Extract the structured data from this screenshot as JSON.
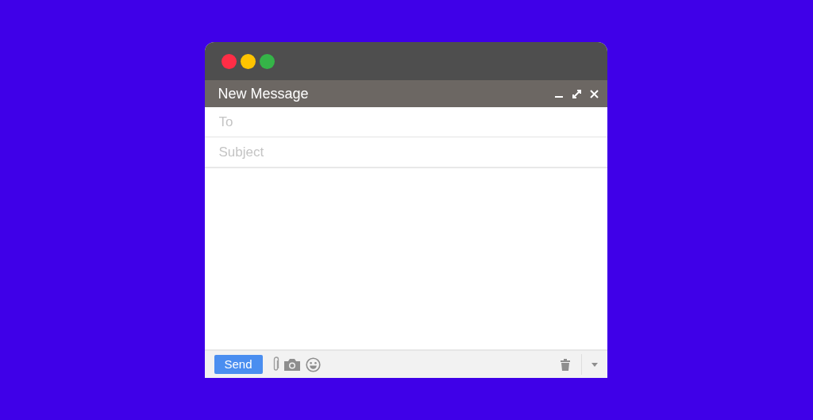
{
  "window": {
    "traffic_lights": [
      {
        "color": "#ff2d46"
      },
      {
        "color": "#ffc400"
      },
      {
        "color": "#35b448"
      }
    ]
  },
  "compose": {
    "title": "New Message",
    "to_field": {
      "placeholder": "To"
    },
    "subject_field": {
      "placeholder": "Subject"
    },
    "send_button": "Send"
  }
}
